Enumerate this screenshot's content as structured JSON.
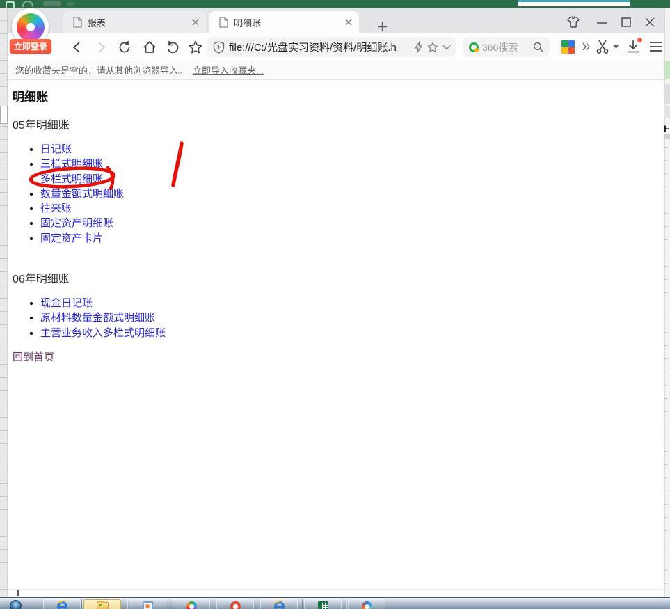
{
  "excel": {
    "partial_char": "H"
  },
  "browser": {
    "login_badge": "立即登录",
    "tabs": [
      {
        "title": "报表"
      },
      {
        "title": "明细账"
      }
    ],
    "address": {
      "url": "file:///C:/光盘实习资料/资料/明细账.h"
    },
    "search": {
      "placeholder": "360搜索"
    },
    "bookmark_bar": {
      "message": "您的收藏夹是空的，请从其他浏览器导入。",
      "import_link": "立即导入收藏夹..."
    }
  },
  "page": {
    "title": "明细账",
    "sections": [
      {
        "heading": "05年明细账",
        "items": [
          "日记账",
          "三栏式明细账",
          "多栏式明细账",
          "数量金额式明细账",
          "往来账",
          "固定资产明细账",
          "固定资产卡片"
        ]
      },
      {
        "heading": "06年明细账",
        "items": [
          "现金日记账",
          "原材料数量金额式明细账",
          "主营业务收入多栏式明细账"
        ]
      }
    ],
    "home_link": "回到首页",
    "annotated_item": "多栏式明细账"
  },
  "colors": {
    "excel_green": "#2a6f4a",
    "link_blue": "#2424cf",
    "visited_purple": "#663366",
    "annotation_red": "#e2140a",
    "tabbar_gray": "#e2e4e8"
  }
}
